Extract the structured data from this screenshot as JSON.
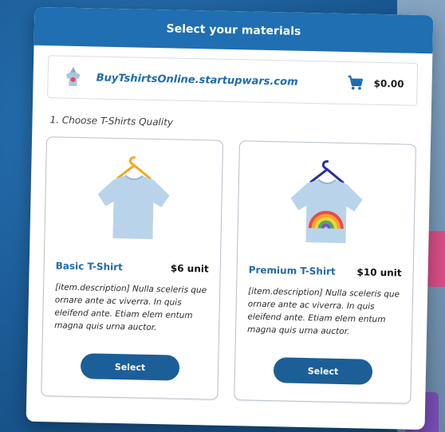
{
  "window": {
    "title": "Select your materials"
  },
  "site": {
    "logo_icon": "rocket-shirt-logo-icon",
    "name": "BuyTshirtsOnline.startupwars.com",
    "cart_icon": "shopping-cart-icon",
    "cart_total": "$0.00"
  },
  "step": {
    "title": "1. Choose T-Shirts Quality"
  },
  "products": [
    {
      "icon": "plain-tshirt-icon",
      "name": "Basic T-Shirt",
      "price": "$6 unit",
      "description": "[item.description] Nulla sceleris que ornare ante ac viverra. In quis eleifend ante. Etiam elem entum magna quis urna auctor.",
      "button": "Select",
      "hanger_color": "#f5a623"
    },
    {
      "icon": "rainbow-tshirt-icon",
      "name": "Premium T-Shirt",
      "price": "$10 unit",
      "description": "[item.description] Nulla sceleris que ornare ante ac viverra. In quis eleifend ante. Etiam elem entum magna quis urna auctor.",
      "button": "Select",
      "hanger_color": "#2c2f9e"
    }
  ],
  "colors": {
    "titlebar": "#1f6fb2",
    "accent": "#1d6bb0",
    "button": "#1c5e98",
    "shirt": "#b9d4ea"
  }
}
